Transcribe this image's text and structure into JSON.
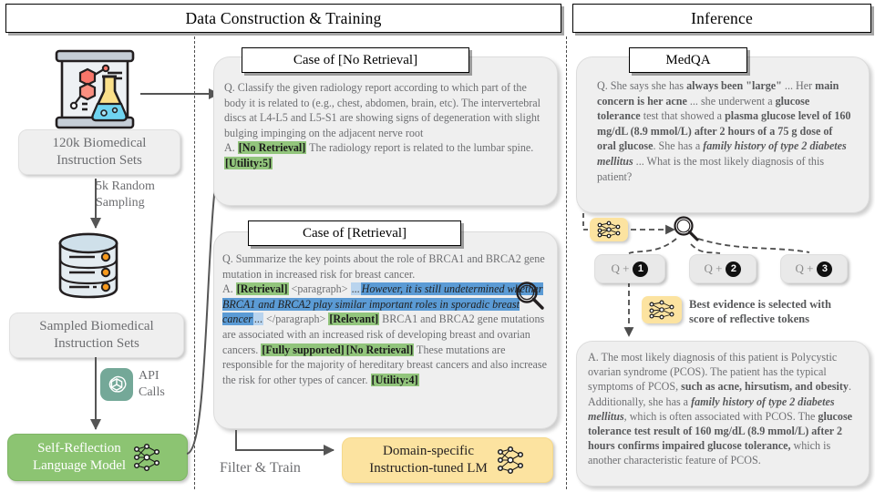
{
  "headers": {
    "left": "Data Construction & Training",
    "right": "Inference"
  },
  "left_column": {
    "lab_icon": "lab-flask-icon",
    "dataset_box": "120k Biomedical\nInstruction Sets",
    "dataset_line1": "120k Biomedical",
    "dataset_line2": "Instruction Sets",
    "sampling_label_line1": "5k Random",
    "sampling_label_line2": "Sampling",
    "database_icon": "database-icon",
    "sampled_line1": "Sampled Biomedical",
    "sampled_line2": "Instruction Sets",
    "api_icon": "openai-logo-icon",
    "api_label_line1": "API",
    "api_label_line2": "Calls",
    "model_line1": "Self-Reflection",
    "model_line2": "Language  Model",
    "model_icon": "neural-network-icon"
  },
  "case_no_retrieval": {
    "label": "Case of [No Retrieval]",
    "question": "Q. Classify the given radiology report according  to which part of the body it is related to (e.g., chest, abdomen, brain, etc). The intervertebral  discs at L4-L5 and L5-S1 are showing signs of degeneration with slight bulging impinging on the adjacent nerve root",
    "answer_prefix": "A. ",
    "token_no_retrieval": "[No Retrieval]",
    "answer_text": " The radiology  report is related to the lumbar spine. ",
    "token_utility": "[Utility:5]"
  },
  "case_retrieval": {
    "label": "Case of [Retrieval]",
    "question": "Q. Summarize the key points about the role of BRCA1 and BRCA2 gene mutation in increased risk for breast cancer.",
    "answer_prefix": "A. ",
    "token_retrieval": "[Retrieval]",
    "paragraph_open": " <paragraph> ",
    "ellipsis_start": "...",
    "passage": "However,  it is still undetermined  whether  BRCA1 and BRCA2 play similar important roles in sporadic breast cancer",
    "ellipsis_end": "...",
    "paragraph_close": " </paragraph> ",
    "token_relevant": "[Relevant]",
    "body_1": " BRCA1 and BRCA2 gene mutations are associated with an increased risk of developing breast and ovarian cancers. ",
    "token_fully_supported": "[Fully supported]",
    "token_no_retrieval": "[No Retrieval]",
    "body_2": " These mutations are responsible for the majority of hereditary breast cancers  and also increase the risk for other types of cancer. ",
    "token_utility": "[Utility:4]",
    "search_icon": "magnifier-icon"
  },
  "train_flow": {
    "filter_label": "Filter & Train",
    "output_line1": "Domain-specific",
    "output_line2": "Instruction-tuned  LM",
    "output_icon": "neural-network-icon"
  },
  "inference": {
    "medqa_label": "MedQA",
    "question_segments": [
      {
        "text": "Q. She says she has ",
        "style": "normal"
      },
      {
        "text": "always been \"large\"",
        "style": "bold"
      },
      {
        "text": " ... Her ",
        "style": "normal"
      },
      {
        "text": "main concern is her acne",
        "style": "bold"
      },
      {
        "text": " ... she underwent a ",
        "style": "normal"
      },
      {
        "text": "glucose tolerance",
        "style": "bold"
      },
      {
        "text": " test that showed a ",
        "style": "normal"
      },
      {
        "text": "plasma glucose level of 160 mg/dL (8.9 mmol/L) after 2 hours of a 75 g dose of oral glucose",
        "style": "bold"
      },
      {
        "text": ". She has a ",
        "style": "normal"
      },
      {
        "text": "family history of type 2 diabetes mellitus",
        "style": "bolditalic"
      },
      {
        "text": " ... What is the most likely diagnosis of this patient?",
        "style": "normal"
      }
    ],
    "token_icon": "reflective-token-icon",
    "search_icon": "magnifier-icon",
    "candidates": [
      {
        "prefix": "Q +",
        "num": "1"
      },
      {
        "prefix": "Q +",
        "num": "2"
      },
      {
        "prefix": "Q +",
        "num": "3"
      }
    ],
    "note_line1": "Best evidence is selected with",
    "note_line2": "score of reflective tokens",
    "answer_segments": [
      {
        "text": "A. The most likely diagnosis of this patient is Polycystic ovarian syndrome (PCOS). The patient has the typical symptoms of PCOS, ",
        "style": "normal"
      },
      {
        "text": "such as acne, hirsutism, and obesity",
        "style": "bold"
      },
      {
        "text": ". Additionally, she has a ",
        "style": "normal"
      },
      {
        "text": "family history of type 2 diabetes mellitus",
        "style": "bolditalic"
      },
      {
        "text": ", which is often associated with PCOS. The ",
        "style": "normal"
      },
      {
        "text": "glucose tolerance test result of 160 mg/dL (8.9 mmol/L) after 2 hours confirms impaired glucose tolerance,",
        "style": "bold"
      },
      {
        "text": " which is another characteristic  feature of PCOS.",
        "style": "normal"
      }
    ]
  },
  "colors": {
    "green_token": "#92c57c",
    "blue_passage": "#5b9bd5",
    "green_box": "#8cc472",
    "yellow_box": "#fce3a0",
    "card_grey": "#efefef",
    "openai_teal": "#74a898",
    "text_grey": "#6d6e71"
  }
}
